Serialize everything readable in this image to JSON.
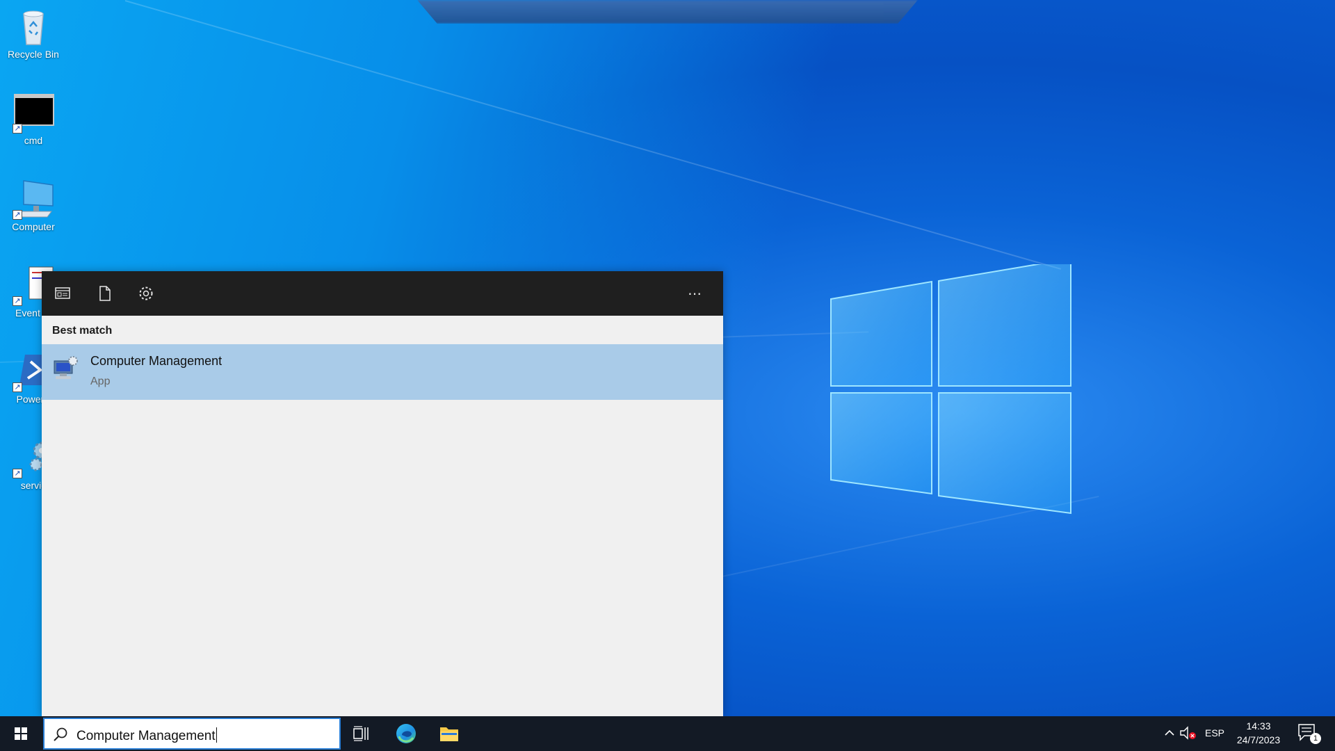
{
  "desktop": {
    "icons": [
      {
        "label": "Recycle Bin",
        "icon": "recycle-bin-icon"
      },
      {
        "label": "cmd",
        "icon": "cmd-icon"
      },
      {
        "label": "Computer",
        "icon": "computer-icon"
      },
      {
        "label": "Event Vi",
        "icon": "event-viewer-icon"
      },
      {
        "label": "PowerS",
        "icon": "powershell-icon"
      },
      {
        "label": "servic",
        "icon": "services-icon"
      }
    ]
  },
  "search_panel": {
    "toolbar": {
      "icons": [
        "apps-filter-icon",
        "documents-filter-icon",
        "settings-filter-icon"
      ],
      "more_label": "⋯"
    },
    "best_match_heading": "Best match",
    "result": {
      "title": "Computer Management",
      "subtitle": "App",
      "icon": "computer-management-icon"
    }
  },
  "taskbar": {
    "search_value": "Computer Management",
    "apps": [
      "task-view-icon",
      "edge-icon",
      "file-explorer-icon"
    ],
    "tray": {
      "language": "ESP",
      "time": "14:33",
      "date": "24/7/2023",
      "notification_count": "1"
    }
  },
  "colors": {
    "accent": "#2a7fd6",
    "selection": "#a9cbe8",
    "taskbar": "#131a25",
    "toolbar": "#1f1f1f"
  }
}
